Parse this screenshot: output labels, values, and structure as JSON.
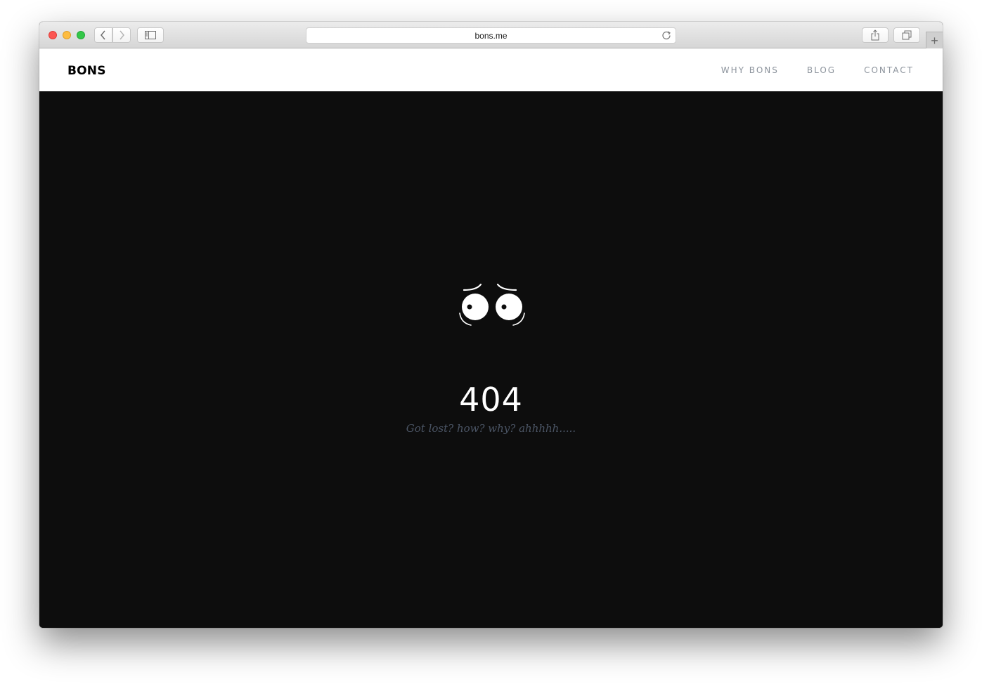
{
  "browser": {
    "url": "bons.me",
    "icons": {
      "back": "chevron-left-icon",
      "forward": "chevron-right-icon",
      "sidebar": "sidebar-icon",
      "reload": "reload-icon",
      "share": "share-icon",
      "tabs": "tabs-overview-icon",
      "new_tab": "plus-icon"
    },
    "new_tab_glyph": "+"
  },
  "site": {
    "logo": "BONS",
    "nav": [
      {
        "label": "WHY BONS"
      },
      {
        "label": "BLOG"
      },
      {
        "label": "CONTACT"
      }
    ]
  },
  "error": {
    "code": "404",
    "message": "Got lost? how? why? ahhhhh.....",
    "illustration": "worried-eyes-icon"
  },
  "colors": {
    "page_background": "#0d0d0d",
    "header_background": "#ffffff",
    "nav_text": "#8c939c",
    "message_text": "#4b5565",
    "code_text": "#ffffff"
  }
}
